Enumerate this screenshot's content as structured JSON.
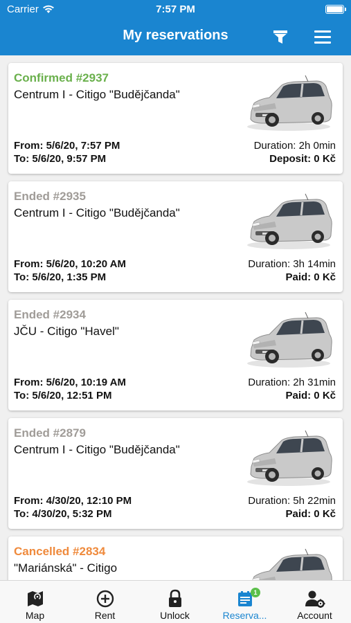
{
  "status_bar": {
    "carrier": "Carrier",
    "time": "7:57 PM"
  },
  "header": {
    "title": "My reservations",
    "filter_icon": "filter-icon",
    "menu_icon": "hamburger-menu-icon"
  },
  "colors": {
    "primary": "#1a85d0",
    "confirmed": "#6ab04c",
    "ended": "#a09c98",
    "cancelled": "#ef8a3c",
    "badge": "#5bbf4a"
  },
  "reservations": [
    {
      "status": "Confirmed #2937",
      "location": "Centrum I - Citigo \"Budějčanda\"",
      "from": "From: 5/6/20, 7:57 PM",
      "to": "To: 5/6/20, 9:57 PM",
      "duration": "Duration: 2h 0min",
      "fee": "Deposit: 0 Kč"
    },
    {
      "status": "Ended #2935",
      "location": "Centrum I - Citigo \"Budějčanda\"",
      "from": "From: 5/6/20, 10:20 AM",
      "to": "To: 5/6/20, 1:35 PM",
      "duration": "Duration: 3h 14min",
      "fee": "Paid: 0 Kč"
    },
    {
      "status": "Ended #2934",
      "location": "JČU - Citigo \"Havel\"",
      "from": "From: 5/6/20, 10:19 AM",
      "to": "To: 5/6/20, 12:51 PM",
      "duration": "Duration: 2h 31min",
      "fee": "Paid: 0 Kč"
    },
    {
      "status": "Ended #2879",
      "location": "Centrum I - Citigo \"Budějčanda\"",
      "from": "From: 4/30/20, 12:10 PM",
      "to": "To: 4/30/20, 5:32 PM",
      "duration": "Duration: 5h 22min",
      "fee": "Paid: 0 Kč"
    },
    {
      "status": "Cancelled #2834",
      "location": "\"Mariánská\" - Citigo",
      "from": "",
      "to": "",
      "duration": "",
      "fee": ""
    }
  ],
  "tabs": [
    {
      "label": "Map",
      "icon": "map-icon"
    },
    {
      "label": "Rent",
      "icon": "plus-circle-icon"
    },
    {
      "label": "Unlock",
      "icon": "padlock-icon"
    },
    {
      "label": "Reserva...",
      "icon": "reservations-list-icon",
      "badge": "1"
    },
    {
      "label": "Account",
      "icon": "account-settings-icon"
    }
  ]
}
